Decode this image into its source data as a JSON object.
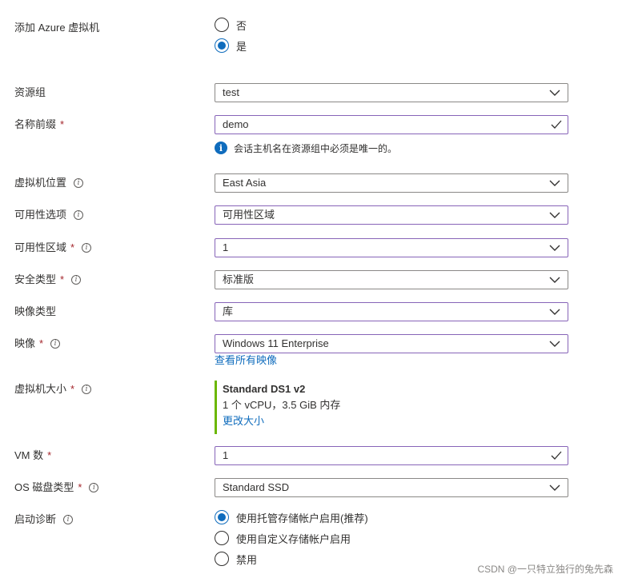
{
  "add_vm": {
    "label": "添加 Azure 虚拟机",
    "options": [
      {
        "label": "否",
        "selected": false
      },
      {
        "label": "是",
        "selected": true
      }
    ]
  },
  "resource_group": {
    "label": "资源组",
    "value": "test"
  },
  "name_prefix": {
    "label": "名称前缀",
    "required": "*",
    "value": "demo",
    "hint": "会话主机名在资源组中必须是唯一的。"
  },
  "vm_location": {
    "label": "虚拟机位置",
    "value": "East Asia"
  },
  "availability_options": {
    "label": "可用性选项",
    "value": "可用性区域"
  },
  "availability_zone": {
    "label": "可用性区域",
    "required": "*",
    "value": "1"
  },
  "security_type": {
    "label": "安全类型",
    "required": "*",
    "value": "标准版"
  },
  "image_type": {
    "label": "映像类型",
    "value": "库"
  },
  "image": {
    "label": "映像",
    "required": "*",
    "value": "Windows 11 Enterprise",
    "link": "查看所有映像"
  },
  "vm_size": {
    "label": "虚拟机大小",
    "required": "*",
    "name": "Standard DS1 v2",
    "description": "1 个 vCPU，3.5 GiB 内存",
    "link": "更改大小"
  },
  "vm_count": {
    "label": "VM 数",
    "required": "*",
    "value": "1"
  },
  "os_disk_type": {
    "label": "OS 磁盘类型",
    "required": "*",
    "value": "Standard SSD"
  },
  "boot_diagnostics": {
    "label": "启动诊断",
    "options": [
      {
        "label": "使用托管存储帐户启用(推荐)",
        "selected": true
      },
      {
        "label": "使用自定义存储帐户启用",
        "selected": false
      },
      {
        "label": "禁用",
        "selected": false
      }
    ]
  },
  "watermark": "CSDN @一只特立独行的兔先森",
  "colors": {
    "accent": "#0f6cbd",
    "focus_border": "#8764b8",
    "required": "#a4262c",
    "success": "#6bb700"
  }
}
